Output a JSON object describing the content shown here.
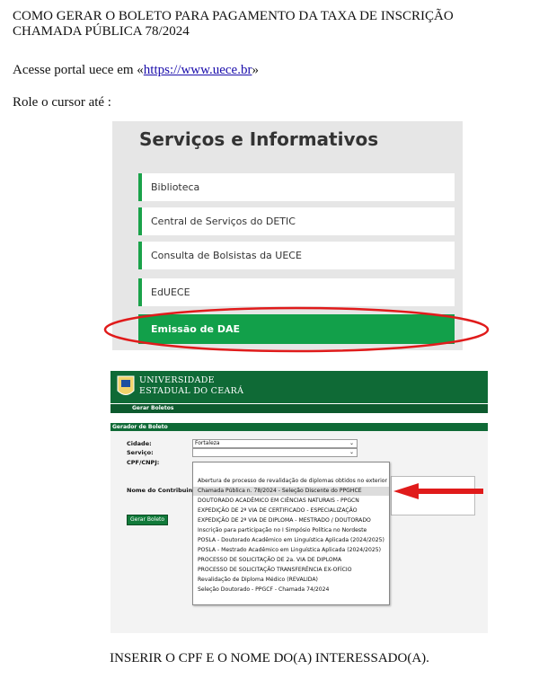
{
  "doc": {
    "title": "COMO GERAR O BOLETO PARA PAGAMENTO DA TAXA DE INSCRIÇÃO CHAMADA PÚBLICA 78/2024",
    "access_prefix": "Acesse portal uece em «",
    "access_link": "https://www.uece.br",
    "access_suffix": "»",
    "role": "Role o cursor até :",
    "footer": "INSERIR O CPF E O NOME DO(A) INTERESSADO(A)."
  },
  "services": {
    "heading": "Serviços e Informativos",
    "items": [
      {
        "label": "Biblioteca"
      },
      {
        "label": "Central de Serviços do DETIC"
      },
      {
        "label": "Consulta de Bolsistas da UECE"
      },
      {
        "label": "EdUECE"
      },
      {
        "label": "Emissão de DAE"
      }
    ],
    "active_color": "#12a04a",
    "highlight_color": "#e01b1b"
  },
  "boleto": {
    "uni_line1": "UNIVERSIDADE",
    "uni_line2": "ESTADUAL DO CEARÁ",
    "nav_item": "Gerar Boletos",
    "section": "Gerador de Boleto",
    "labels": {
      "cidade": "Cidade:",
      "servico": "Serviço:",
      "cpf": "CPF/CNPJ:",
      "nome": "Nome do Contribuinte:"
    },
    "cidade_value": "Fortaleza",
    "button": "Gerar Boleto",
    "options": [
      "Abertura de processo de revalidação de diplomas obtidos no exterior",
      "Chamada Pública n. 78/2024 - Seleção Discente do PPGHCE",
      "DOUTORADO ACADÊMICO EM CIÊNCIAS NATURAIS - PPGCN",
      "EXPEDIÇÃO DE 2ª VIA DE CERTIFICADO - ESPECIALIZAÇÃO",
      "EXPEDIÇÃO DE 2ª VIA DE DIPLOMA - MESTRADO / DOUTORADO",
      "Inscrição para participação no I Simpósio Política no Nordeste",
      "POSLA - Doutorado Acadêmico em Linguística Aplicada (2024/2025)",
      "POSLA - Mestrado Acadêmico em Linguística Aplicada (2024/2025)",
      "PROCESSO DE SOLICITAÇÃO DE 2a. VIA DE DIPLOMA",
      "PROCESSO DE SOLICITAÇÃO TRANSFERÊNCIA EX-OFÍCIO",
      "Revalidação de Diploma Médico (REVALIDA)",
      "Seleção Doutorado - PPGCF - Chamada 74/2024"
    ],
    "highlighted_index": 1,
    "header_color": "#0f6a36"
  }
}
